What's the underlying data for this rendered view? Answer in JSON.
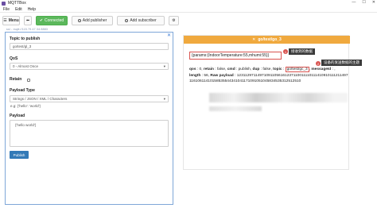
{
  "window": {
    "title": "MQTTBox",
    "controls": [
      "—",
      "☐",
      "✕"
    ]
  },
  "menubar": {
    "items": [
      "File",
      "Edit",
      "Help"
    ]
  },
  "toolbar": {
    "menu_label": "Menu",
    "back_glyph": "⬅",
    "connected_label": "Connected",
    "add_publisher_label": "Add publisher",
    "add_subscriber_label": "Add subscriber",
    "gear_glyph": "⚙"
  },
  "connection_label": "ssl - mqtt://115.79.47.34:8883",
  "publisher": {
    "close_glyph": "✕",
    "topic_label": "Topic to publish",
    "topic_value": "go/test/gl_3",
    "qos_label": "QoS",
    "qos_value": "0 - Almost Once",
    "retain_label": "Retain",
    "payload_type_label": "Payload Type",
    "payload_type_value": "Strings / JSON / XML / Characters",
    "payload_hint": "e.g: {'hello': 'world'}",
    "payload_label": "Payload",
    "payload_value": "{'hello world'}",
    "publish_label": "Publish"
  },
  "subscriber": {
    "header_label": "go/test/go_3",
    "header_close": "✕",
    "message": "{params:{IndoorTemperature:55,mhumi:55}}",
    "annotation_1": {
      "badge": "1",
      "text": "接收到的数据"
    },
    "annotation_2": {
      "badge": "2",
      "text": "设备的发送数据的主题"
    },
    "meta": {
      "qos_k": "qos",
      "qos_v": "0",
      "retain_k": "retain",
      "retain_v": "false",
      "cmd_k": "cmd",
      "cmd_v": "publish",
      "dup_k": "dup",
      "dup_v": "false",
      "topic_k": "topic",
      "topic_v": "go/test/gc_3",
      "msgid_k": "messageId",
      "msgid_v": "",
      "length_k": "length",
      "length_v": "56",
      "raw_k": "Raw payload",
      "raw_v": "12311297114971091105616123711001111011141091011121149711610611410158535544341041171091051045834535312512510"
    }
  }
}
